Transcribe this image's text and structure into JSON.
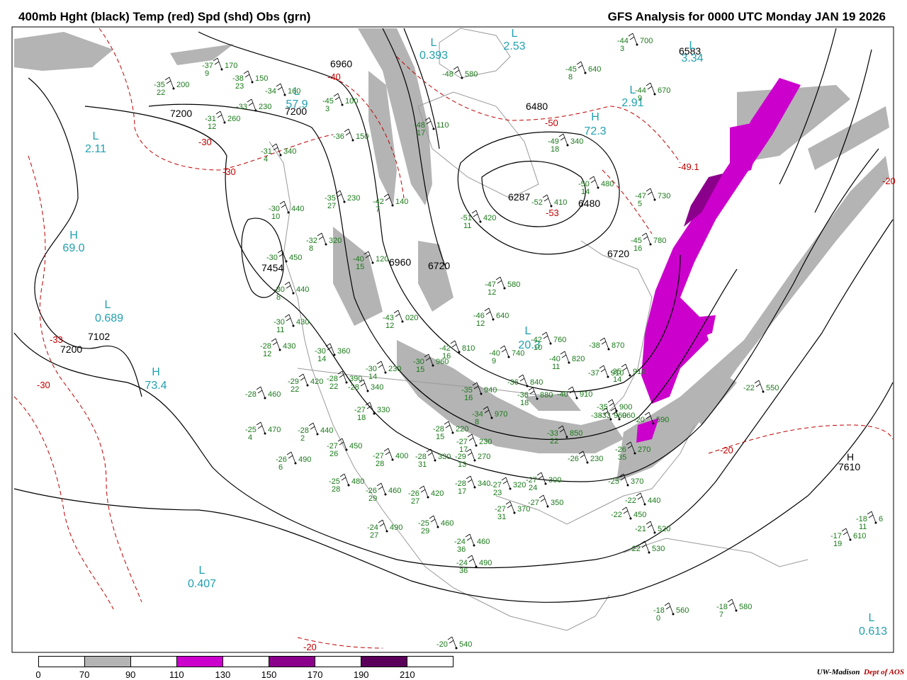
{
  "title_left": "400mb Hght (black) Temp (red) Spd (shd) Obs (grn)",
  "title_right": "GFS Analysis for 0000 UTC Monday  JAN 19 2026",
  "credit": {
    "org": "UW-Madison",
    "dept": "Dept of AOS"
  },
  "legend": {
    "segment_colors": [
      "#ffffff",
      "#b4b4b4",
      "#ffffff",
      "#cc00cc",
      "#ffffff",
      "#8b008b",
      "#ffffff",
      "#5a005a",
      "#ffffff"
    ],
    "labels": [
      "0",
      "70",
      "90",
      "110",
      "130",
      "150",
      "170",
      "190",
      "210"
    ]
  },
  "colors": {
    "height": "#000000",
    "temp": "#c00000",
    "obs": "#1a7a1a",
    "extrema": "#20a0b0",
    "coast": "#9a9a9a",
    "speed_70": "#b4b4b4",
    "speed_110": "#cc00cc",
    "speed_150": "#8b008b"
  },
  "height_labels": [
    "6960",
    "7200",
    "7200",
    "6480",
    "6287",
    "6480",
    "6720",
    "6960",
    "6720",
    "7454",
    "7102",
    "7200",
    "6583",
    "7610"
  ],
  "temp_labels": [
    "-40",
    "-30",
    "-30",
    "-50",
    "-49.1",
    "-53",
    "-20",
    "-20",
    "-20",
    "-30",
    "-33"
  ],
  "extrema": [
    {
      "letter": "L",
      "value": "0.393"
    },
    {
      "letter": "L",
      "value": "2.53"
    },
    {
      "letter": "L",
      "value": "3.34"
    },
    {
      "letter": "L",
      "value": "57.9"
    },
    {
      "letter": "L",
      "value": "2.91"
    },
    {
      "letter": "H",
      "value": "72.3"
    },
    {
      "letter": "L",
      "value": "2.11"
    },
    {
      "letter": "H",
      "value": "69.0"
    },
    {
      "letter": "L",
      "value": "0.689"
    },
    {
      "letter": "H",
      "value": "73.4"
    },
    {
      "letter": "L",
      "value": "0.407"
    },
    {
      "letter": "L",
      "value": "20.3"
    },
    {
      "letter": "L",
      "value": "0.613"
    },
    {
      "letter": "H",
      "value": ""
    }
  ],
  "observations": [
    {
      "t": "-37",
      "h": "170",
      "d": "9"
    },
    {
      "t": "-38",
      "h": "150",
      "d": "23"
    },
    {
      "t": "-35",
      "h": "200",
      "d": "22"
    },
    {
      "t": "-34",
      "h": "160",
      "d": ""
    },
    {
      "t": "-33",
      "h": "230",
      "d": ""
    },
    {
      "t": "-31",
      "h": "260",
      "d": "12"
    },
    {
      "t": "-31",
      "h": "340",
      "d": "4"
    },
    {
      "t": "-30",
      "h": "440",
      "d": "10"
    },
    {
      "t": "-32",
      "h": "320",
      "d": "8"
    },
    {
      "t": "-30",
      "h": "450",
      "d": ""
    },
    {
      "t": "-30",
      "h": "440",
      "d": "8"
    },
    {
      "t": "-30",
      "h": "430",
      "d": "11"
    },
    {
      "t": "-28",
      "h": "430",
      "d": "12"
    },
    {
      "t": "-30",
      "h": "360",
      "d": "14"
    },
    {
      "t": "-29",
      "h": "420",
      "d": "22"
    },
    {
      "t": "-28",
      "h": "460",
      "d": ""
    },
    {
      "t": "-28",
      "h": "390",
      "d": "22"
    },
    {
      "t": "-28",
      "h": "340",
      "d": ""
    },
    {
      "t": "-30",
      "h": "230",
      "d": "14"
    },
    {
      "t": "-25",
      "h": "470",
      "d": "4"
    },
    {
      "t": "-28",
      "h": "440",
      "d": "2"
    },
    {
      "t": "-27",
      "h": "450",
      "d": "26"
    },
    {
      "t": "-26",
      "h": "490",
      "d": "6"
    },
    {
      "t": "-27",
      "h": "400",
      "d": "28"
    },
    {
      "t": "-28",
      "h": "330",
      "d": "31"
    },
    {
      "t": "-25",
      "h": "480",
      "d": "28"
    },
    {
      "t": "-26",
      "h": "460",
      "d": "29"
    },
    {
      "t": "-26",
      "h": "420",
      "d": "27"
    },
    {
      "t": "-24",
      "h": "490",
      "d": "27"
    },
    {
      "t": "-25",
      "h": "460",
      "d": "29"
    },
    {
      "t": "-24",
      "h": "460",
      "d": "36"
    },
    {
      "t": "-24",
      "h": "490",
      "d": "36"
    },
    {
      "t": "-20",
      "h": "540",
      "d": ""
    },
    {
      "t": "-27",
      "h": "330",
      "d": "18"
    },
    {
      "t": "-28",
      "h": "220",
      "d": "15"
    },
    {
      "t": "-27",
      "h": "230",
      "d": "17"
    },
    {
      "t": "-29",
      "h": "270",
      "d": "13"
    },
    {
      "t": "-28",
      "h": "340",
      "d": "17"
    },
    {
      "t": "-27",
      "h": "320",
      "d": "23"
    },
    {
      "t": "-27",
      "h": "370",
      "d": "31"
    },
    {
      "t": "-27",
      "h": "350",
      "d": ""
    },
    {
      "t": "-27",
      "h": "300",
      "d": "24"
    },
    {
      "t": "-36",
      "h": "150",
      "d": ""
    },
    {
      "t": "-35",
      "h": "230",
      "d": "27"
    },
    {
      "t": "-42",
      "h": "140",
      "d": "7"
    },
    {
      "t": "-40",
      "h": "120",
      "d": "15"
    },
    {
      "t": "-43",
      "h": "020",
      "d": "12"
    },
    {
      "t": "-45",
      "h": "100",
      "d": "3"
    },
    {
      "t": "-48",
      "h": "110",
      "d": "17"
    },
    {
      "t": "-48",
      "h": "580",
      "d": ""
    },
    {
      "t": "-51",
      "h": "420",
      "d": "11"
    },
    {
      "t": "-49",
      "h": "340",
      "d": "18"
    },
    {
      "t": "-52",
      "h": "410",
      "d": ""
    },
    {
      "t": "-50",
      "h": "480",
      "d": "14"
    },
    {
      "t": "-45",
      "h": "640",
      "d": "8"
    },
    {
      "t": "-44",
      "h": "700",
      "d": "3"
    },
    {
      "t": "-44",
      "h": "670",
      "d": "9"
    },
    {
      "t": "-47",
      "h": "730",
      "d": "5"
    },
    {
      "t": "-45",
      "h": "780",
      "d": "16"
    },
    {
      "t": "-47",
      "h": "580",
      "d": "12"
    },
    {
      "t": "-46",
      "h": "640",
      "d": "12"
    },
    {
      "t": "-42",
      "h": "760",
      "d": "10"
    },
    {
      "t": "-40",
      "h": "820",
      "d": "11"
    },
    {
      "t": "-38",
      "h": "870",
      "d": ""
    },
    {
      "t": "-37",
      "h": "910",
      "d": ""
    },
    {
      "t": "-40",
      "h": "910",
      "d": ""
    },
    {
      "t": "-40",
      "h": "740",
      "d": "9"
    },
    {
      "t": "-42",
      "h": "810",
      "d": "16"
    },
    {
      "t": "-36",
      "h": "840",
      "d": ""
    },
    {
      "t": "-36",
      "h": "880",
      "d": "18"
    },
    {
      "t": "-35",
      "h": "940",
      "d": "16"
    },
    {
      "t": "-34",
      "h": "970",
      "d": "8"
    },
    {
      "t": "-33",
      "h": "850",
      "d": "22"
    },
    {
      "t": "-30",
      "h": "960",
      "d": "15"
    },
    {
      "t": "-38",
      "h": "960",
      "d": ""
    },
    {
      "t": "-35",
      "h": "900",
      "d": ""
    },
    {
      "t": "-33",
      "h": "960",
      "d": ""
    },
    {
      "t": "-26",
      "h": "270",
      "d": "35"
    },
    {
      "t": "-25",
      "h": "370",
      "d": ""
    },
    {
      "t": "-22",
      "h": "440",
      "d": ""
    },
    {
      "t": "-22",
      "h": "450",
      "d": ""
    },
    {
      "t": "-21",
      "h": "520",
      "d": ""
    },
    {
      "t": "-22",
      "h": "530",
      "d": ""
    },
    {
      "t": "-18",
      "h": "560",
      "d": "0"
    },
    {
      "t": "-18",
      "h": "580",
      "d": "7"
    },
    {
      "t": "-17",
      "h": "610",
      "d": "19"
    },
    {
      "t": "-18",
      "h": "6",
      "d": "11"
    },
    {
      "t": "-22",
      "h": "550",
      "d": ""
    },
    {
      "t": "-26",
      "h": "230",
      "d": ""
    },
    {
      "t": "-20",
      "h": "590",
      "d": ""
    },
    {
      "t": "-35",
      "h": "910",
      "d": "14"
    }
  ]
}
